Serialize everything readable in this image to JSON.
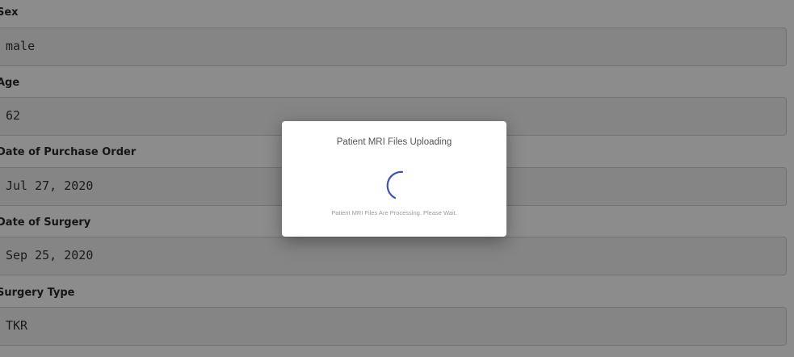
{
  "form": {
    "fields": [
      {
        "label": "Sex",
        "value": "male"
      },
      {
        "label": "Age",
        "value": "62"
      },
      {
        "label": "Date of Purchase Order",
        "value": "Jul 27, 2020"
      },
      {
        "label": "Date of Surgery",
        "value": "Sep 25, 2020"
      },
      {
        "label": "Surgery Type",
        "value": "TKR"
      }
    ]
  },
  "modal": {
    "title": "Patient MRI Files Uploading",
    "message": "Patient MRI Files Are Processing. Please Wait.",
    "spinner_icon": "loading-spinner-icon",
    "spinner_color": "#3f51b5"
  }
}
